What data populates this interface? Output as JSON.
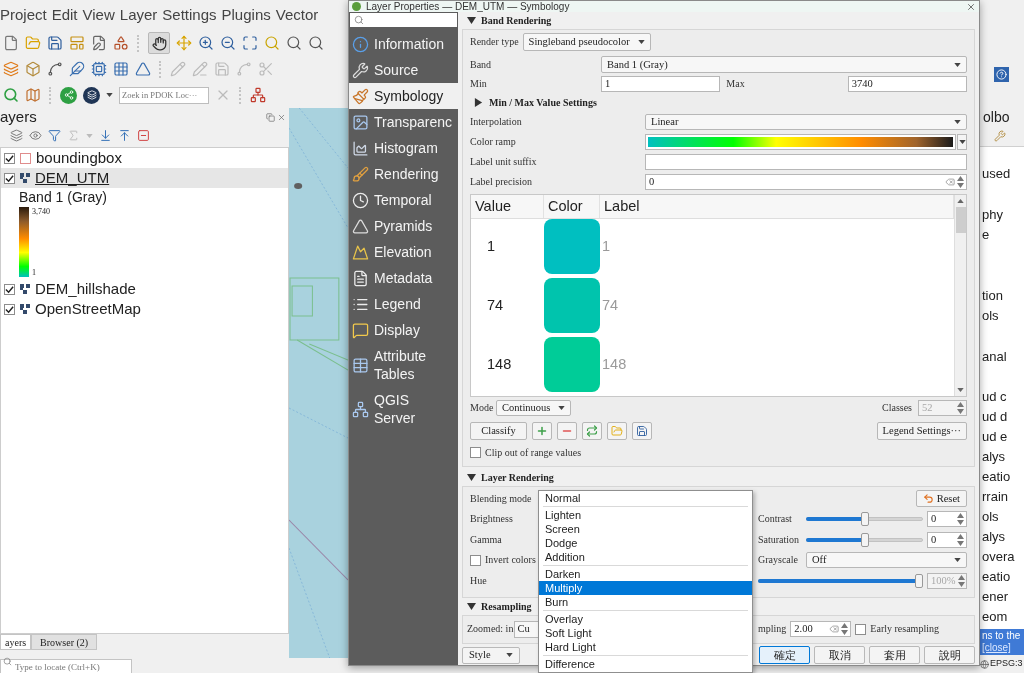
{
  "main_window": {
    "menu_bar": [
      "Project",
      "Edit",
      "View",
      "Layer",
      "Settings",
      "Plugins",
      "Vector"
    ],
    "locator_search": {
      "placeholder": "Zoek in PDOK Loc···"
    },
    "layers_panel": {
      "title": "ayers",
      "layers": [
        {
          "name": "boundingbox",
          "kind": "vector",
          "checked": true,
          "selected": false
        },
        {
          "name": "DEM_UTM",
          "kind": "raster",
          "checked": true,
          "selected": true,
          "legend": {
            "band": "Band 1 (Gray)",
            "max_label": "3,740",
            "min_label": "1"
          }
        },
        {
          "name": "DEM_hillshade",
          "kind": "raster",
          "checked": true,
          "selected": false
        },
        {
          "name": "OpenStreetMap",
          "kind": "raster",
          "checked": true,
          "selected": false
        }
      ],
      "tabs": [
        {
          "label": "ayers",
          "selected": true
        },
        {
          "label": "Browser (2)",
          "selected": false
        }
      ],
      "locate": {
        "placeholder": "Type to locate (Ctrl+K)"
      }
    },
    "toolbox_strip": {
      "title": "olbo",
      "groups": [
        [
          "used"
        ],
        [
          "phy",
          "e"
        ],
        [
          "tion",
          "ols"
        ],
        [
          "anal"
        ],
        [
          "ud c",
          "ud d",
          "ud e",
          "alys",
          "eatio",
          "rrain",
          "ols",
          "alys",
          "overa",
          "eatio",
          "ener",
          "eom"
        ]
      ],
      "message": {
        "text": "ns to the",
        "link": "[close]"
      },
      "crs": "EPSG:3"
    }
  },
  "dialog": {
    "title": "Layer Properties — DEM_UTM — Symbology",
    "sidebar": [
      {
        "label": "Information",
        "selected": false
      },
      {
        "label": "Source",
        "selected": false
      },
      {
        "label": "Symbology",
        "selected": true
      },
      {
        "label": "Transparenc",
        "selected": false
      },
      {
        "label": "Histogram",
        "selected": false
      },
      {
        "label": "Rendering",
        "selected": false
      },
      {
        "label": "Temporal",
        "selected": false
      },
      {
        "label": "Pyramids",
        "selected": false
      },
      {
        "label": "Elevation",
        "selected": false
      },
      {
        "label": "Metadata",
        "selected": false
      },
      {
        "label": "Legend",
        "selected": false
      },
      {
        "label": "Display",
        "selected": false
      },
      {
        "label": "Attribute Tables",
        "selected": false
      },
      {
        "label": "QGIS Server",
        "selected": false
      }
    ],
    "band_rendering": {
      "title": "Band Rendering",
      "expanded": true,
      "render_type": {
        "label": "Render type",
        "value": "Singleband pseudocolor"
      },
      "band": {
        "label": "Band",
        "value": "Band 1 (Gray)"
      },
      "min": {
        "label": "Min",
        "value": "1"
      },
      "max": {
        "label": "Max",
        "value": "3740"
      },
      "minmax_settings": {
        "label": "Min / Max Value Settings",
        "expanded": false
      },
      "interpolation": {
        "label": "Interpolation",
        "value": "Linear"
      },
      "color_ramp": {
        "label": "Color ramp"
      },
      "label_unit_suffix": {
        "label": "Label unit suffix"
      },
      "label_precision": {
        "label": "Label precision",
        "value": "0"
      },
      "table": {
        "columns": [
          "Value",
          "Color",
          "Label"
        ],
        "rows": [
          {
            "value": "1",
            "color": "#00bfc0",
            "label": "1"
          },
          {
            "value": "74",
            "color": "#00c4ad",
            "label": "74"
          },
          {
            "value": "148",
            "color": "#00cc98",
            "label": "148"
          }
        ]
      },
      "mode": {
        "label": "Mode",
        "value": "Continuous"
      },
      "classes": {
        "label": "Classes",
        "value": "52",
        "disabled": true
      },
      "classify_button": "Classify",
      "legend_settings_button": "Legend Settings···",
      "clip": {
        "label": "Clip out of range values",
        "checked": false
      }
    },
    "layer_rendering": {
      "title": "Layer Rendering",
      "expanded": true,
      "blending_mode": {
        "label": "Blending mode",
        "open": true,
        "option_groups": [
          [
            {
              "label": "Normal",
              "selected": false
            }
          ],
          [
            {
              "label": "Lighten",
              "selected": false
            },
            {
              "label": "Screen",
              "selected": false
            },
            {
              "label": "Dodge",
              "selected": false
            },
            {
              "label": "Addition",
              "selected": false
            }
          ],
          [
            {
              "label": "Darken",
              "selected": false
            },
            {
              "label": "Multiply",
              "selected": true
            },
            {
              "label": "Burn",
              "selected": false
            }
          ],
          [
            {
              "label": "Overlay",
              "selected": false
            },
            {
              "label": "Soft Light",
              "selected": false
            },
            {
              "label": "Hard Light",
              "selected": false
            }
          ],
          [
            {
              "label": "Difference",
              "selected": false
            }
          ]
        ]
      },
      "reset_button": "Reset",
      "brightness": {
        "label": "Brightness"
      },
      "contrast": {
        "label": "Contrast",
        "level": 0.5,
        "value": "0"
      },
      "gamma": {
        "label": "Gamma"
      },
      "saturation": {
        "label": "Saturation",
        "level": 0.5,
        "value": "0"
      },
      "invert_colors": {
        "label": "Invert colors",
        "checked": false
      },
      "grayscale": {
        "label": "Grayscale",
        "value": "Off"
      },
      "hue": {
        "label": "Hue"
      },
      "colorize_strength": {
        "level": 1,
        "value": "100%",
        "disabled": true
      }
    },
    "resampling": {
      "title": "Resampling",
      "expanded": true,
      "zoomed_in": {
        "label": "Zoomed: in",
        "value": "Cu"
      },
      "oversampling": {
        "label": "mpling",
        "value": "2.00"
      },
      "early_resampling": {
        "label": "Early resampling",
        "checked": false
      }
    },
    "style_button": "Style",
    "buttons": [
      {
        "label": "確定",
        "focused": true
      },
      {
        "label": "取消",
        "focused": false
      },
      {
        "label": "套用",
        "focused": false
      },
      {
        "label": "說明",
        "focused": false
      }
    ]
  }
}
